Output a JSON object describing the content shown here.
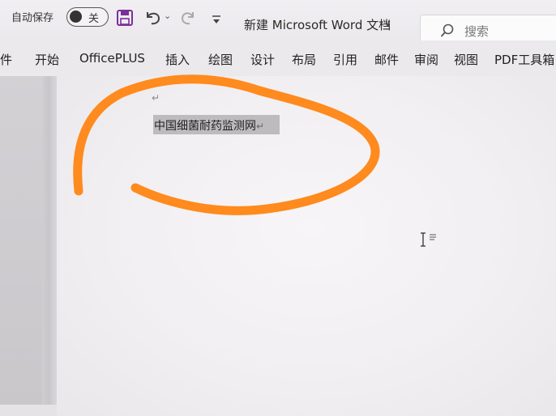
{
  "titlebar": {
    "autosave_label": "自动保存",
    "autosave_state": "关",
    "doc_title": "新建 Microsoft Word 文档",
    "doc_title_caret": "∨",
    "undo_caret": "⌄"
  },
  "search": {
    "placeholder": "搜索"
  },
  "ribbon": {
    "tabs": [
      "件",
      "开始",
      "OfficePLUS",
      "插入",
      "绘图",
      "设计",
      "布局",
      "引用",
      "邮件",
      "审阅",
      "视图",
      "PDF工具箱"
    ]
  },
  "document": {
    "paragraph_mark": "↵",
    "text": "中国细菌耐药监测网"
  },
  "colors": {
    "annotation_stroke": "#ff8a1e",
    "save_icon": "#7b2f9a",
    "text_highlight": "#bdbbbe"
  }
}
